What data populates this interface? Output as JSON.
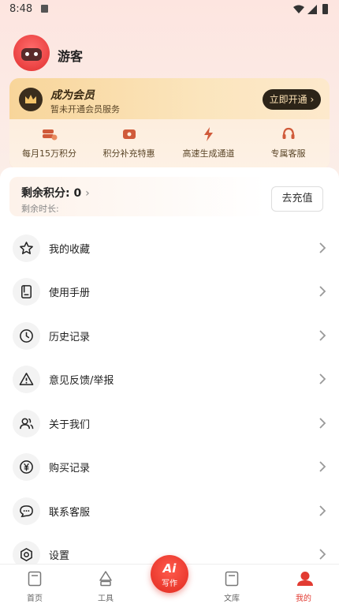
{
  "status_bar": {
    "time": "8:48"
  },
  "user": {
    "name": "游客"
  },
  "vip": {
    "title": "成为会员",
    "subtitle": "暂未开通会员服务",
    "open_button": "立即开通",
    "perks": [
      {
        "label": "每月15万积分",
        "icon": "coins-icon"
      },
      {
        "label": "积分补充特惠",
        "icon": "ticket-icon"
      },
      {
        "label": "高速生成通道",
        "icon": "lightning-icon"
      },
      {
        "label": "专属客服",
        "icon": "headset-icon"
      }
    ]
  },
  "points": {
    "label": "剩余积分:",
    "value": "0",
    "time_label": "剩余时长:",
    "recharge_button": "去充值"
  },
  "menu": [
    {
      "label": "我的收藏",
      "icon": "star-icon"
    },
    {
      "label": "使用手册",
      "icon": "manual-icon"
    },
    {
      "label": "历史记录",
      "icon": "clock-icon"
    },
    {
      "label": "意见反馈/举报",
      "icon": "warning-icon"
    },
    {
      "label": "关于我们",
      "icon": "people-icon"
    },
    {
      "label": "购买记录",
      "icon": "yuan-icon"
    },
    {
      "label": "联系客服",
      "icon": "chat-icon"
    },
    {
      "label": "设置",
      "icon": "settings-icon"
    }
  ],
  "nav": {
    "home": "首页",
    "tools": "工具",
    "write_ai": "Ai",
    "write": "写作",
    "library": "文库",
    "mine": "我的"
  },
  "colors": {
    "accent": "#e23b32",
    "vip_dark": "#2c2418",
    "vip_gold": "#f8d59a"
  }
}
